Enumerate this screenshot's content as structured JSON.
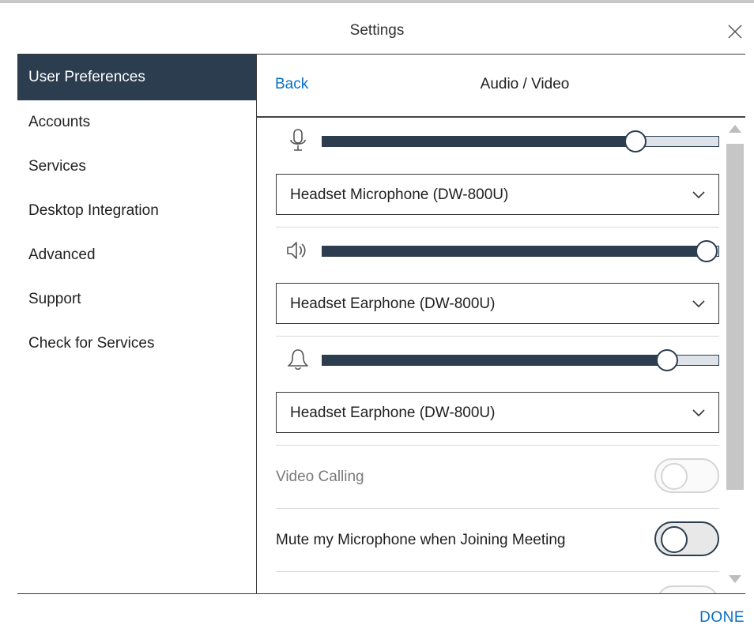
{
  "window": {
    "title": "Settings"
  },
  "sidebar": {
    "items": [
      {
        "label": "User Preferences",
        "active": true
      },
      {
        "label": "Accounts"
      },
      {
        "label": "Services"
      },
      {
        "label": "Desktop Integration"
      },
      {
        "label": "Advanced"
      },
      {
        "label": "Support"
      },
      {
        "label": "Check for Services"
      }
    ]
  },
  "panel": {
    "back_label": "Back",
    "title": "Audio / Video",
    "microphone": {
      "icon": "microphone-icon",
      "volume_fraction": 0.79,
      "device": "Headset Microphone (DW-800U)"
    },
    "speaker": {
      "icon": "speaker-icon",
      "volume_fraction": 0.97,
      "device": "Headset Earphone (DW-800U)"
    },
    "ringer": {
      "icon": "bell-icon",
      "volume_fraction": 0.87,
      "device": "Headset Earphone (DW-800U)"
    },
    "video_calling": {
      "label": "Video Calling",
      "enabled": false,
      "disabled": true
    },
    "mute_on_join": {
      "label": "Mute my Microphone when Joining Meeting",
      "enabled": false
    }
  },
  "footer": {
    "done_label": "DONE"
  },
  "colors": {
    "accent": "#0a6fc2",
    "dark": "#2b3d4f",
    "track": "#dde3e8"
  }
}
